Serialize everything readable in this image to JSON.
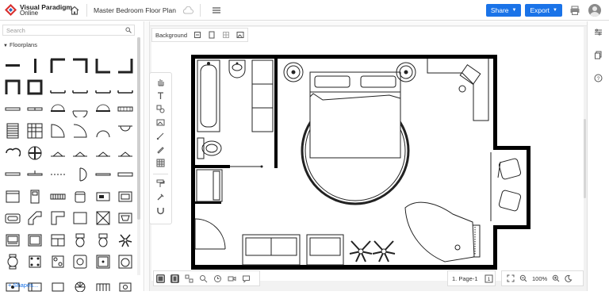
{
  "app": {
    "brand_line1": "Visual Paradigm",
    "brand_line2": "Online",
    "document_title": "Master Bedroom Floor Plan"
  },
  "toolbar": {
    "share_label": "Share",
    "export_label": "Export"
  },
  "left_panel": {
    "search_placeholder": "Search",
    "section_title": "Floorplans",
    "more_shapes_label": "+ Shapes..."
  },
  "canvas": {
    "background_label": "Background"
  },
  "bottom": {
    "page_label": "1. Page-1",
    "page_count": "1",
    "zoom_label": "100%"
  }
}
